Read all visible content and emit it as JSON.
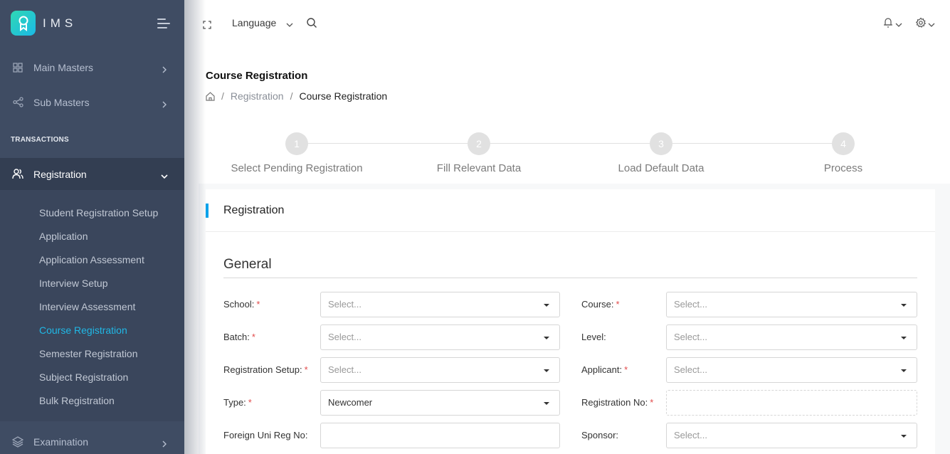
{
  "app": {
    "name": "IMS",
    "colors": {
      "sidebar": "#3f4c63",
      "accent": "#20b8e6",
      "required": "#e24b4b",
      "card_accent": "#0aa2ea"
    }
  },
  "sidebar": {
    "menu_items": [
      {
        "label": "Main Masters",
        "icon": "grid-icon"
      },
      {
        "label": "Sub Masters",
        "icon": "share-icon"
      }
    ],
    "section_title": "TRANSACTIONS",
    "registration": {
      "label": "Registration",
      "icon": "users-icon",
      "expanded": true
    },
    "sub_items": [
      {
        "label": "Student Registration Setup",
        "active": false
      },
      {
        "label": "Application",
        "active": false
      },
      {
        "label": "Application Assessment",
        "active": false
      },
      {
        "label": "Interview Setup",
        "active": false
      },
      {
        "label": "Interview Assessment",
        "active": false
      },
      {
        "label": "Course Registration",
        "active": true
      },
      {
        "label": "Semester Registration",
        "active": false
      },
      {
        "label": "Subject Registration",
        "active": false
      },
      {
        "label": "Bulk Registration",
        "active": false
      }
    ],
    "examination": {
      "label": "Examination",
      "icon": "layers-icon"
    }
  },
  "topbar": {
    "language_label": "Language",
    "icons": [
      "fullscreen-icon",
      "search-icon",
      "bell-icon",
      "gear-icon"
    ]
  },
  "page": {
    "title": "Course Registration",
    "breadcrumb": [
      {
        "label": "Registration"
      },
      {
        "label": "Course Registration"
      }
    ]
  },
  "stepper": {
    "steps": [
      {
        "number": "1",
        "label": "Select Pending Registration"
      },
      {
        "number": "2",
        "label": "Fill Relevant Data"
      },
      {
        "number": "3",
        "label": "Load Default Data"
      },
      {
        "number": "4",
        "label": "Process"
      }
    ]
  },
  "card": {
    "title": "Registration",
    "section": "General",
    "fields": {
      "school": {
        "label": "School:",
        "required": "*",
        "value": "Select..."
      },
      "course": {
        "label": "Course:",
        "required": "*",
        "value": "Select..."
      },
      "batch": {
        "label": "Batch:",
        "required": "*",
        "value": "Select..."
      },
      "level": {
        "label": "Level:",
        "value": "Select..."
      },
      "registration_setup": {
        "label": "Registration Setup:",
        "required": "*",
        "value": "Select..."
      },
      "applicant": {
        "label": "Applicant:",
        "required": "*",
        "value": "Select..."
      },
      "type": {
        "label": "Type:",
        "required": "*",
        "value": "Newcomer"
      },
      "registration_no": {
        "label": "Registration No:",
        "required": "*",
        "value": ""
      },
      "foreign_uni_reg_no": {
        "label": "Foreign Uni Reg No:",
        "value": ""
      },
      "sponsor": {
        "label": "Sponsor:",
        "value": "Select..."
      }
    }
  }
}
